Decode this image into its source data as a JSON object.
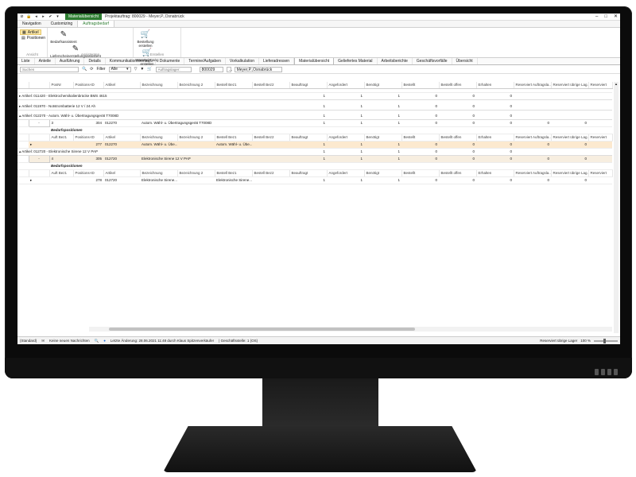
{
  "titlebar": {
    "context_tab": "Materialübersicht",
    "title": "Projektauftrag: 800029 - Meyer,P.,Osnabrück"
  },
  "ribbon_tabs": [
    "Navigation",
    "Customizing",
    "Auftragsbedarf"
  ],
  "ribbon": {
    "ansicht": {
      "items": [
        "Artikel",
        "Positionen"
      ],
      "label": "Ansicht"
    },
    "assistenten": {
      "items": [
        "Bedarfsassistent",
        "Lieferscheinerstellungsassistent"
      ],
      "label": "Assistenten"
    },
    "erstellen": {
      "items": [
        "Bestellung erstellen",
        "Wareneingang erstellen"
      ],
      "label": "Erstellen"
    }
  },
  "nav_tabs": [
    "Liste",
    "Anteile",
    "Ausführung",
    "Details",
    "Kommunikationsverlauf",
    "Dokumente",
    "Termine/Aufgaben",
    "Vorkalkulation",
    "Lieferadressen",
    "Materialübersicht",
    "Geliefertes Material",
    "Arbeitsberichte",
    "Geschäftsvorfälle",
    "Übersicht"
  ],
  "toolbar": {
    "search_placeholder": "Suchen",
    "filter_label": "Filter",
    "filter_value": "Alle",
    "lager_placeholder": "Auftragslager:",
    "project_no": "800029",
    "customer": "Meyer,P.,Osnabrück"
  },
  "grid": {
    "columns": [
      "",
      "",
      "PosNr",
      "Positions-ID",
      "Artikel",
      "Bezeichnung",
      "Bezeichnung 2",
      "Bestell Bez1",
      "Bestell Bez2",
      "Beauftragt",
      "Angefordert",
      "Benötigt",
      "Bestellt",
      "Bestellt offen",
      "Erhalten",
      "Reserviert Auftragsla...",
      "Reserviert übrige Lag...",
      "Reserviert"
    ],
    "groups": [
      {
        "label": "Artikel: 011420 - Elektrochemikalienbrücke BMS 4615",
        "values": [
          "1",
          "1",
          "1",
          "0",
          "0",
          "0"
        ]
      },
      {
        "label": "Artikel: 011970 - Notstrombatterie 12 V / 24 Ah",
        "values": [
          "1",
          "1",
          "1",
          "0",
          "0",
          "0"
        ]
      },
      {
        "label": "Artikel: 012270 - Autom. Wähl- u. Übertragungsgerät T7008D",
        "values": [
          "1",
          "1",
          "1",
          "0",
          "0",
          "0"
        ]
      },
      {
        "label": "Artikel: 012720 - Elektronische Sirene 12 V PAP",
        "values": [
          "1",
          "1",
          "1",
          "0",
          "0",
          "0"
        ]
      }
    ],
    "pos_rows": [
      {
        "minus": "-",
        "posnr": "3",
        "pid": "304",
        "artikel": "012270",
        "bez": "Autom. Wähl- u. Übertragungsgerät T7008D",
        "vals": [
          "1",
          "1",
          "1",
          "0",
          "0",
          "0",
          "0",
          "0"
        ]
      },
      {
        "minus": "-",
        "posnr": "4",
        "pid": "305",
        "artikel": "012720",
        "bez": "Elektronische Sirene 12 V PAP",
        "vals": [
          "1",
          "1",
          "1",
          "0",
          "0",
          "0",
          "0",
          "0"
        ]
      }
    ],
    "sub_caption": "Bedarfspositionen",
    "sub_columns": [
      "Auft Bez1",
      "Positions-ID",
      "Artikel",
      "Bezeichnung",
      "Bezeichnung 2",
      "Bestell Bez1",
      "Bestell Bez2",
      "Beauftragt",
      "Angefordert",
      "Benötigt",
      "Bestellt",
      "Bestellt offen",
      "Erhalten",
      "Reserviert Auftragsla...",
      "Reserviert übrige Lag...",
      "Reserviert"
    ],
    "sub_rows": [
      {
        "pid": "277",
        "artikel": "012270",
        "bez": "Autom. Wähl- u. Übe...",
        "bbez1": "Autom. Wähl- u. Übe...",
        "vals": [
          "1",
          "1",
          "1",
          "0",
          "0",
          "0",
          "0",
          "0"
        ]
      },
      {
        "pid": "278",
        "artikel": "012720",
        "bez": "Elektronische Sirene...",
        "bbez1": "Elektronische Sirene...",
        "vals": [
          "1",
          "1",
          "1",
          "0",
          "0",
          "0",
          "0",
          "0"
        ]
      }
    ]
  },
  "statusbar": {
    "standard": "(Standard)",
    "messages": "Keine neuen Nachrichten",
    "last_change": "Letzte Änderung: 28.06.2021 11:48 durch Klaus Spitzenverkäufer",
    "branch": "| Geschäftsstelle: 1 (OS)",
    "right_label": "Reserviert übrige Lager",
    "zoom": "100 %"
  }
}
